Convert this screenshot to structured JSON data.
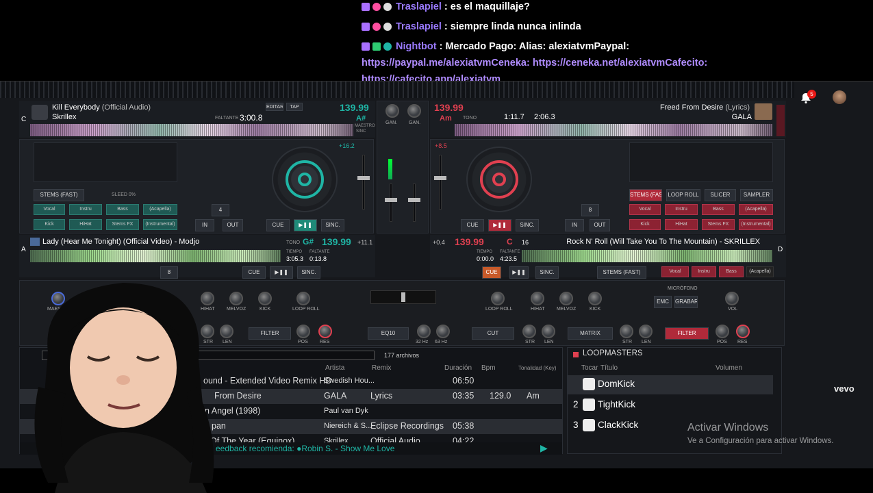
{
  "chat": [
    {
      "user": "Traslapiel",
      "message": ": es el maquillaje?"
    },
    {
      "user": "Traslapiel",
      "message": ": siempre linda nunca inlinda"
    },
    {
      "user": "Nightbot",
      "message": ": Mercado Pago: Alias: alexiatvmPaypal:"
    }
  ],
  "chat_links": [
    "https://paypal.me/alexiatvmCeneka: https://ceneka.net/alexiatvmCafecito:",
    "https://cafecito.app/alexiatvm"
  ],
  "notifications": "5",
  "deck_c": {
    "letter": "C",
    "title": "Kill Everybody",
    "title_suffix": "(Official Audio)",
    "artist": "Skrillex",
    "remaining_label": "FALTANTE",
    "remaining": "3:00.8",
    "bpm": "139.99",
    "key": "A#",
    "edit": "EDITAR",
    "tap": "TAP",
    "master": "MAESTRO",
    "sync_small": "SINC"
  },
  "deck_b": {
    "bpm": "139.99",
    "key": "Am",
    "tempo_label": "TONO",
    "time1": "1:11.7",
    "time2": "2:06.3",
    "title": "Freed From Desire",
    "title_suffix": "(Lyrics)",
    "artist": "GALA"
  },
  "deck_a": {
    "letter": "A",
    "title": "Lady (Hear Me Tonight) (Official Video) - Modjo",
    "tone": "TONO",
    "key": "G#",
    "bpm": "139.99",
    "tempo_label": "TIEMPO",
    "tempo": "3:05.3",
    "remaining_label": "FALTANTE",
    "remaining": "0:13.8",
    "pitch": "+11.1"
  },
  "deck_d": {
    "letter": "D",
    "bpm": "139.99",
    "key": "C",
    "loop": "16",
    "tempo_label": "TIEMPO",
    "tempo": "0:00.0",
    "remaining_label": "FALTANTE",
    "remaining": "4:23.5",
    "title": "Rock N' Roll (Will Take You To The Mountain) - SKRILLEX",
    "pitch": "+0.4"
  },
  "controls": {
    "cue": "CUE",
    "sync": "SINC.",
    "in": "IN",
    "out": "OUT",
    "gain": "GAN.",
    "stems": "STEMS (FAST)",
    "speed": "SLEED 0%",
    "loop_roll": "LOOP ROLL",
    "slicer": "SLICER",
    "sampler": "SAMPLER",
    "loop_c": "4",
    "loop_b": "8",
    "loop_a": "8",
    "pitch_c": "+16.2",
    "pitch_b": "+8.5"
  },
  "pads_left": [
    "Vocal",
    "Instru",
    "Bass",
    "(Acapella)",
    "Kick",
    "HiHat",
    "Stems FX",
    "(Instrumental)"
  ],
  "pads_right": [
    "Vocal",
    "Instru",
    "Bass",
    "(Acapella)",
    "Kick",
    "HiHat",
    "Stems FX",
    "(Instrumental)"
  ],
  "pads_d": [
    "Vocal",
    "Instru",
    "Bass",
    "(Acapella)"
  ],
  "mixer": {
    "master": "MAESTRO",
    "hihat": "HIHAT",
    "melvoz": "MELVOZ",
    "kick": "KICK",
    "loop_roll": "LOOP ROLL",
    "cut": "CUT",
    "filter": "FILTER",
    "str": "STR",
    "len": "LEN",
    "pos": "POS",
    "res": "RES",
    "eq": "EQ10",
    "hz32": "32 Hz",
    "hz63": "63 Hz",
    "matrix": "MATRIX",
    "microphone": "MICRÓFONO",
    "emc": "EMC",
    "record": "GRABAR",
    "vol": "VOL"
  },
  "browser": {
    "count": "177 archivos",
    "columns": [
      "Artista",
      "Remix",
      "Duración",
      "Bpm",
      "Tonalidad (Key)"
    ],
    "rows": [
      {
        "title": "ound - Extended Video Remix HD",
        "artist": "Swedish Hou...",
        "remix": "",
        "duration": "06:50",
        "bpm": "",
        "key": ""
      },
      {
        "title": "From Desire",
        "artist": "GALA",
        "remix": "Lyrics",
        "duration": "03:35",
        "bpm": "129.0",
        "key": "Am"
      },
      {
        "title": "n Angel (1998)",
        "artist": "Paul van Dyk",
        "remix": "",
        "duration": "",
        "bpm": "",
        "key": ""
      },
      {
        "title": "pan",
        "artist": "Niereich & S...",
        "remix": "Eclipse Recordings",
        "duration": "05:38",
        "bpm": "",
        "key": ""
      },
      {
        "title": "Of The Year (Equinox)",
        "artist": "Skrillex",
        "remix": "Official Audio",
        "duration": "04:22",
        "bpm": "",
        "key": ""
      }
    ],
    "feedback": "eedback recomienda: ●Robin S. - Show Me Love"
  },
  "loopmasters": {
    "title": "LOOPMASTERS",
    "col_play": "Tocar",
    "col_title": "Título",
    "col_volume": "Volumen",
    "rows": [
      {
        "n": "",
        "name": "DomKick"
      },
      {
        "n": "2",
        "name": "TightKick"
      },
      {
        "n": "3",
        "name": "ClackKick"
      }
    ]
  },
  "overlay": {
    "vevo": "vevo",
    "activate_title": "Activar Windows",
    "activate_sub": "Ve a Configuración para activar Windows."
  },
  "colors": {
    "teal": "#1fb5a5",
    "red": "#e04050",
    "username": "#9b7bff",
    "link": "#b08cff"
  }
}
